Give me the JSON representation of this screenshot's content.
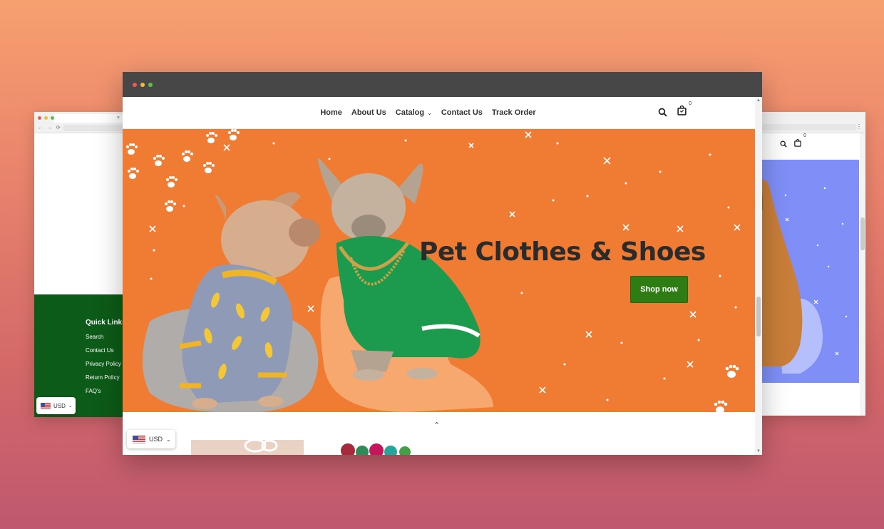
{
  "colors": {
    "hero_background": "#f07c34",
    "shop_button": "#2e7d14",
    "footer_background": "#0d5b18",
    "right_hero_background": "#7f8ff7",
    "titlebar": "#474747"
  },
  "main_browser": {
    "nav": {
      "items": [
        {
          "label": "Home"
        },
        {
          "label": "About Us"
        },
        {
          "label": "Catalog",
          "has_dropdown": true
        },
        {
          "label": "Contact Us"
        },
        {
          "label": "Track Order"
        }
      ],
      "cart_count": "0"
    },
    "hero": {
      "title": "Pet Clothes & Shoes",
      "cta_label": "Shop now"
    },
    "currency": "USD"
  },
  "left_browser": {
    "tab_close": "×",
    "nav_controls": "← → ⟳",
    "footer": {
      "heading": "Quick Links",
      "links": [
        "Search",
        "Contact Us",
        "Privacy Policy",
        "Return Policy",
        "FAQ's"
      ]
    },
    "currency": "USD"
  },
  "right_browser": {
    "cart_count": "0",
    "menu": "⋮"
  }
}
